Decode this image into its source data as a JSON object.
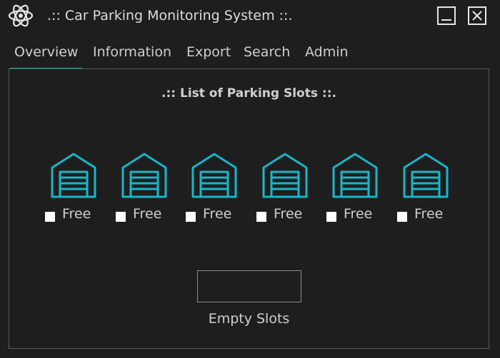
{
  "window": {
    "title": ".:: Car Parking Monitoring System ::.",
    "app_icon": "atom-icon",
    "controls": {
      "minimize": "minimize-icon",
      "close": "close-icon"
    }
  },
  "tabs": [
    {
      "label": "Overview",
      "active": true
    },
    {
      "label": "Information",
      "active": false
    },
    {
      "label": "Export",
      "active": false
    },
    {
      "label": "Search",
      "active": false
    },
    {
      "label": "Admin",
      "active": false
    }
  ],
  "overview": {
    "heading": ".:: List of Parking Slots ::.",
    "slots": [
      {
        "status": "Free",
        "checked": false,
        "icon": "garage-icon"
      },
      {
        "status": "Free",
        "checked": false,
        "icon": "garage-icon"
      },
      {
        "status": "Free",
        "checked": false,
        "icon": "garage-icon"
      },
      {
        "status": "Free",
        "checked": false,
        "icon": "garage-icon"
      },
      {
        "status": "Free",
        "checked": false,
        "icon": "garage-icon"
      },
      {
        "status": "Free",
        "checked": false,
        "icon": "garage-icon"
      }
    ],
    "empty_slots": {
      "value": "",
      "label": "Empty Slots"
    }
  },
  "colors": {
    "background": "#1e1e1e",
    "accent": "#1fa58f",
    "garage_icon": "#19b6c8",
    "text": "#cfcfcf"
  }
}
